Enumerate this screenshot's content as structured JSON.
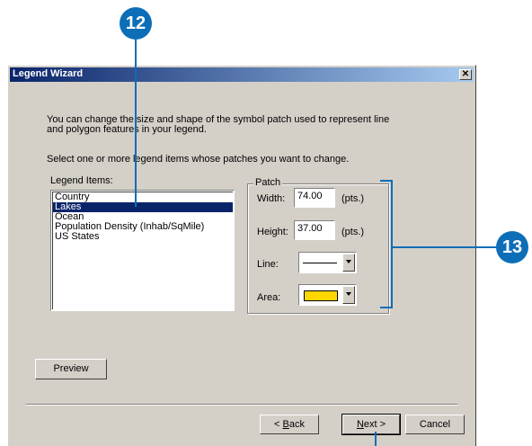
{
  "callouts": {
    "top": "12",
    "right": "13"
  },
  "window": {
    "title": "Legend Wizard",
    "close_glyph": "✕"
  },
  "intro": {
    "line1": "You can change the size and shape of the symbol patch used to represent line",
    "line2": "and polygon features in your legend.",
    "line3": "Select one or more legend items whose patches you want to change."
  },
  "legend_items": {
    "label": "Legend Items:",
    "items": [
      "Country",
      "Lakes",
      "Ocean",
      "Population Density (Inhab/SqMile)",
      "US States"
    ],
    "selected": "Lakes"
  },
  "patch": {
    "label": "Patch",
    "width_label": "Width:",
    "width_value": "74.00",
    "width_unit": "(pts.)",
    "height_label": "Height:",
    "height_value": "37.00",
    "height_unit": "(pts.)",
    "line_label": "Line:",
    "area_label": "Area:",
    "area_color": "#ffd700"
  },
  "buttons": {
    "preview": "Preview",
    "back_key": "B",
    "back_rest": "ack",
    "next_key": "N",
    "next_rest": "ext >",
    "cancel": "Cancel"
  },
  "colors": {
    "callout": "#0d6eb8",
    "title_bar": "#0a246a",
    "selection": "#0a246a"
  }
}
